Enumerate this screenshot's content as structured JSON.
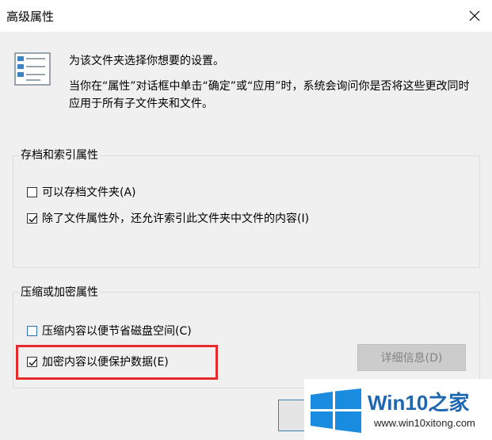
{
  "window": {
    "title": "高级属性"
  },
  "description": {
    "line1": "为该文件夹选择你想要的设置。",
    "line2": "当你在“属性”对话框中单击“确定”或“应用”时，系统会询问你是否将这些更改同时应用于所有子文件夹和文件。"
  },
  "archive_group": {
    "title": "存档和索引属性",
    "options": [
      {
        "label": "可以存档文件夹(A)",
        "checked": false
      },
      {
        "label": "除了文件属性外，还允许索引此文件夹中文件的内容(I)",
        "checked": true
      }
    ]
  },
  "compress_group": {
    "title": "压缩或加密属性",
    "options": [
      {
        "label": "压缩内容以便节省磁盘空间(C)",
        "checked": false
      },
      {
        "label": "加密内容以便保护数据(E)",
        "checked": true
      }
    ],
    "details_label": "详细信息(D)"
  },
  "watermark": {
    "brand": "Win10",
    "brand_suffix": "之家",
    "url": "www.win10xitong.com"
  },
  "colors": {
    "highlight": "#e52b2b",
    "brand_blue": "#1f66b0",
    "disabled_button": "#cccccc"
  },
  "icons": [
    "close-icon",
    "checklist-document-icon",
    "checkbox-checked-icon",
    "checkbox-unchecked-icon",
    "windows-logo-icon"
  ]
}
